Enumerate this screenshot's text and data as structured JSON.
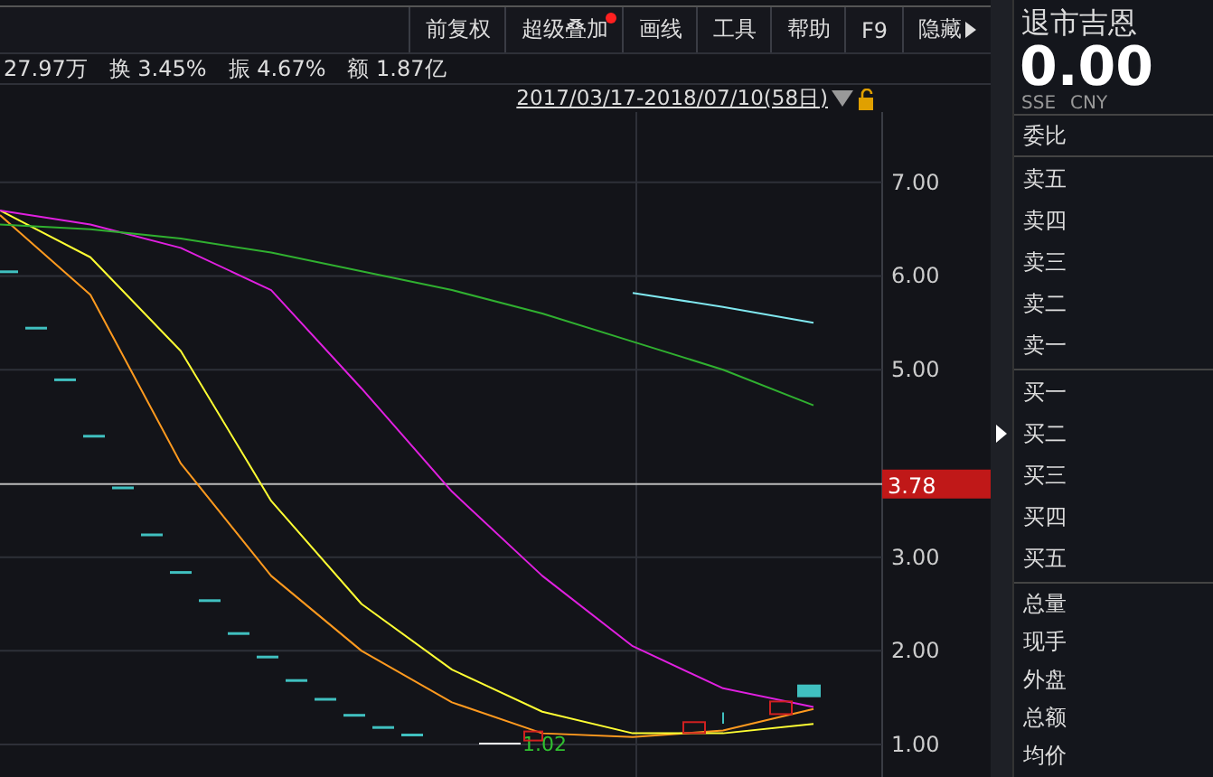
{
  "toolbar": [
    {
      "label": "前复权",
      "badge": false
    },
    {
      "label": "超级叠加",
      "badge": true
    },
    {
      "label": "画线",
      "badge": false
    },
    {
      "label": "工具",
      "badge": false
    },
    {
      "label": "帮助",
      "badge": false
    },
    {
      "label": "F9",
      "badge": false
    },
    {
      "label": "隐藏",
      "badge": false,
      "arrow": true
    }
  ],
  "stats": [
    "27.97万",
    "换 3.45%",
    "振 4.67%",
    "额 1.87亿"
  ],
  "date_range": "2017/03/17-2018/07/10(58日)",
  "chart": {
    "low_label": "1.02",
    "chart_data": {
      "type": "line",
      "grid": true,
      "ref_lines": [
        {
          "axis": "y",
          "value": 3.78,
          "label": "3.78"
        }
      ],
      "categories": [
        null,
        null,
        null,
        null,
        null,
        null,
        null,
        null,
        null,
        null
      ],
      "ylim": [
        0.615,
        7.75
      ],
      "yticks": [
        {
          "value": 1,
          "label": "1.00"
        },
        {
          "value": 2,
          "label": "2.00"
        },
        {
          "value": 3,
          "label": "3.00"
        },
        {
          "value": 5,
          "label": "5.00"
        },
        {
          "value": 6,
          "label": "6.00"
        },
        {
          "value": 7,
          "label": "7.00"
        }
      ],
      "series": [
        {
          "color": "#ff9a1f",
          "values": [
            6.65,
            5.8,
            4.0,
            2.8,
            2.0,
            1.45,
            1.12,
            1.08,
            1.15,
            1.38
          ]
        },
        {
          "color": "#ffff33",
          "values": [
            6.7,
            6.2,
            5.2,
            3.6,
            2.5,
            1.8,
            1.35,
            1.12,
            1.12,
            1.22
          ]
        },
        {
          "color": "#e020e0",
          "values": [
            6.7,
            6.55,
            6.3,
            5.85,
            4.8,
            3.7,
            2.8,
            2.05,
            1.6,
            1.4
          ]
        },
        {
          "color": "#30b030",
          "values": [
            6.55,
            6.5,
            6.4,
            6.25,
            6.05,
            5.85,
            5.6,
            5.3,
            5.0,
            4.62
          ]
        },
        {
          "color": "#80e8f0",
          "values": [
            null,
            null,
            null,
            null,
            null,
            null,
            null,
            5.82,
            5.67,
            5.5
          ]
        }
      ]
    }
  },
  "quote": {
    "name": "退市吉恩",
    "price": "0.00",
    "exchange": "SSE",
    "currency": "CNY"
  },
  "book_header": "委比",
  "asks": [
    "卖五",
    "卖四",
    "卖三",
    "卖二",
    "卖一"
  ],
  "bids": [
    "买一",
    "买二",
    "买三",
    "买四",
    "买五"
  ],
  "totals": [
    "总量",
    "现手",
    "外盘",
    "总额",
    "均价"
  ]
}
